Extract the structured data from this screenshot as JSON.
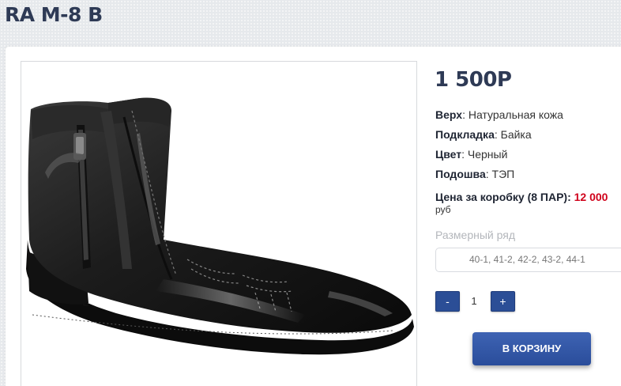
{
  "product": {
    "title": "RA M-8 B",
    "price": "1 500Р"
  },
  "specs": [
    {
      "label": "Верх",
      "value": ": Натуральная кожа"
    },
    {
      "label": "Подкладка",
      "value": ": Байка"
    },
    {
      "label": "Цвет",
      "value": ": Черный"
    },
    {
      "label": "Подошва",
      "value": ": ТЭП"
    }
  ],
  "box_price": {
    "label": "Цена за коробку (8 ПАР):",
    "value": "12 000",
    "currency": "руб"
  },
  "sizes": {
    "label": "Размерный ряд",
    "value": "40-1, 41-2, 42-2, 43-2, 44-1"
  },
  "quantity": {
    "minus": "-",
    "value": "1",
    "plus": "+"
  },
  "cart_button": "В КОРЗИНУ",
  "colors": {
    "title": "#2e3a55",
    "accent": "#2b4e96",
    "price_red": "#d0021b"
  }
}
